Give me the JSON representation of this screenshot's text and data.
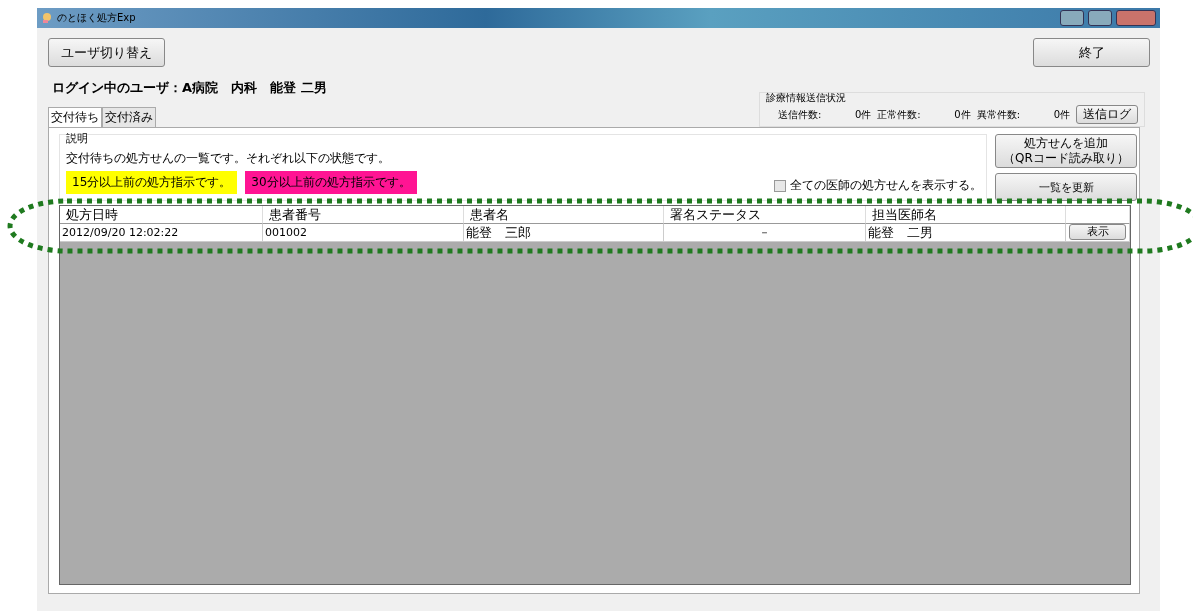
{
  "window": {
    "title": "のとほく処方Exp"
  },
  "switch_user_button": "ユーザ切り替え",
  "exit_button": "終了",
  "login_user": "ログイン中のユーザ：A病院　内科　能登 二男",
  "send_status": {
    "title": "診療情報送信状況",
    "items": [
      {
        "label": "送信件数:",
        "value": "0件"
      },
      {
        "label": "正常件数:",
        "value": "0件"
      },
      {
        "label": "異常件数:",
        "value": "0件"
      }
    ],
    "log_button": "送信ログ"
  },
  "tabs": [
    {
      "label": "交付待ち",
      "selected": true
    },
    {
      "label": "交付済み",
      "selected": false
    }
  ],
  "description": {
    "title": "説明",
    "text": "交付待ちの処方せんの一覧です。それぞれ以下の状態です。",
    "legend": [
      {
        "text": "15分以上前の処方指示です。",
        "color": "#ffff00"
      },
      {
        "text": "30分以上前の処方指示です。",
        "color": "#ff1493"
      }
    ]
  },
  "show_all_doctors": {
    "label": "全ての医師の処方せんを表示する。",
    "checked": false
  },
  "add_button": [
    "処方せんを追加",
    "（QRコード読み取り）"
  ],
  "refresh_button": "一覧を更新",
  "table": {
    "columns": [
      "処方日時",
      "患者番号",
      "患者名",
      "署名ステータス",
      "担当医師名"
    ],
    "rows": [
      {
        "cells": [
          "2012/09/20 12:02:22",
          "001002",
          "能登　三郎",
          "－",
          "能登　二男"
        ],
        "button": "表示",
        "highlighted": true
      }
    ]
  }
}
